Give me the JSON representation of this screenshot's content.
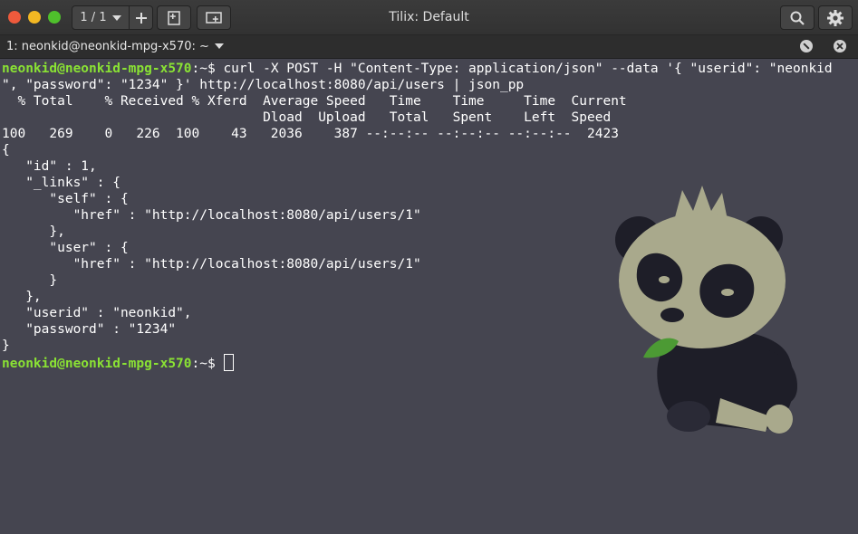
{
  "window": {
    "title": "Tilix: Default",
    "page_indicator": "1 / 1"
  },
  "tab": {
    "label": "1: neonkid@neonkid-mpg-x570: ~"
  },
  "terminal": {
    "prompt_user": "neonkid@neonkid-mpg-x570",
    "prompt_path": ":~$ ",
    "command_line_1": "curl -X POST -H \"Content-Type: application/json\" --data '{ \"userid\": \"neonkid",
    "command_line_2": "\", \"password\": \"1234\" }' http://localhost:8080/api/users | json_pp",
    "curl_header_1": "  % Total    % Received % Xferd  Average Speed   Time    Time     Time  Current",
    "curl_header_2": "                                 Dload  Upload   Total   Spent    Left  Speed",
    "curl_stats": "100   269    0   226  100    43   2036    387 --:--:-- --:--:-- --:--:--  2423",
    "json_lines": [
      "{",
      "   \"id\" : 1,",
      "   \"_links\" : {",
      "      \"self\" : {",
      "         \"href\" : \"http://localhost:8080/api/users/1\"",
      "      },",
      "      \"user\" : {",
      "         \"href\" : \"http://localhost:8080/api/users/1\"",
      "      }",
      "   },",
      "   \"userid\" : \"neonkid\",",
      "   \"password\" : \"1234\"",
      "}"
    ]
  },
  "colors": {
    "terminal_bg": "#454550",
    "prompt_user": "#8ae234",
    "titlebar_bg": "#353535",
    "close": "#ee5a3c",
    "minimize": "#f3b823",
    "maximize": "#4fc02c"
  },
  "icons": {
    "dropdown": "chevron-down-icon",
    "add": "plus-icon",
    "add_terminal_down": "add-terminal-down-icon",
    "add_terminal_right": "add-terminal-right-icon",
    "search": "search-icon",
    "settings": "gear-icon",
    "read_only": "read-only-icon",
    "close_session": "close-icon",
    "background": "panda-mascot-image"
  }
}
